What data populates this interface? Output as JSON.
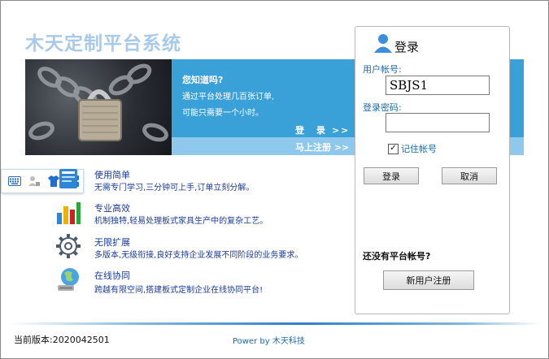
{
  "app": {
    "title": "木天定制平台系统"
  },
  "banner": {
    "tip_title": "您知道吗?",
    "tip_line1": "通过平台处理几百张订单,",
    "tip_line2": "可能只需要一个小时。",
    "login_link": "登　录 >>",
    "register_link": "马上注册 >>"
  },
  "features": [
    {
      "icon": "book-icon",
      "title": "使用简单",
      "desc": "无需专门学习,三分钟可上手,订单立刻分解。"
    },
    {
      "icon": "bar-chart-icon",
      "title": "专业高效",
      "desc": "机制独特,轻易处理板式家具生产中的复杂工艺。"
    },
    {
      "icon": "gear-icon",
      "title": "无限扩展",
      "desc": "多版本,无级衔接,良好支持企业发展不同阶段的业务要求。"
    },
    {
      "icon": "globe-icon",
      "title": "在线协同",
      "desc": "跨越有限空间,搭建板式定制企业在线协同平台!"
    }
  ],
  "login": {
    "title": "登录",
    "account_label": "用户帐号:",
    "account_value": "SBJS1",
    "password_label": "登录密码:",
    "password_value": "",
    "remember_label": "记住帐号",
    "remember_checked": "✓",
    "login_button": "登录",
    "cancel_button": "取消",
    "no_account_text": "还没有平台帐号?",
    "register_button": "新用户注册"
  },
  "footer": {
    "version": "当前版本:2020042501",
    "powered": "Power by  木天科技"
  },
  "colors": {
    "banner_blue": "#3aa0d8",
    "title_light_blue": "#a9c9ea",
    "link_blue": "#1a6aa8",
    "feature_blue": "#1a3a9a"
  }
}
